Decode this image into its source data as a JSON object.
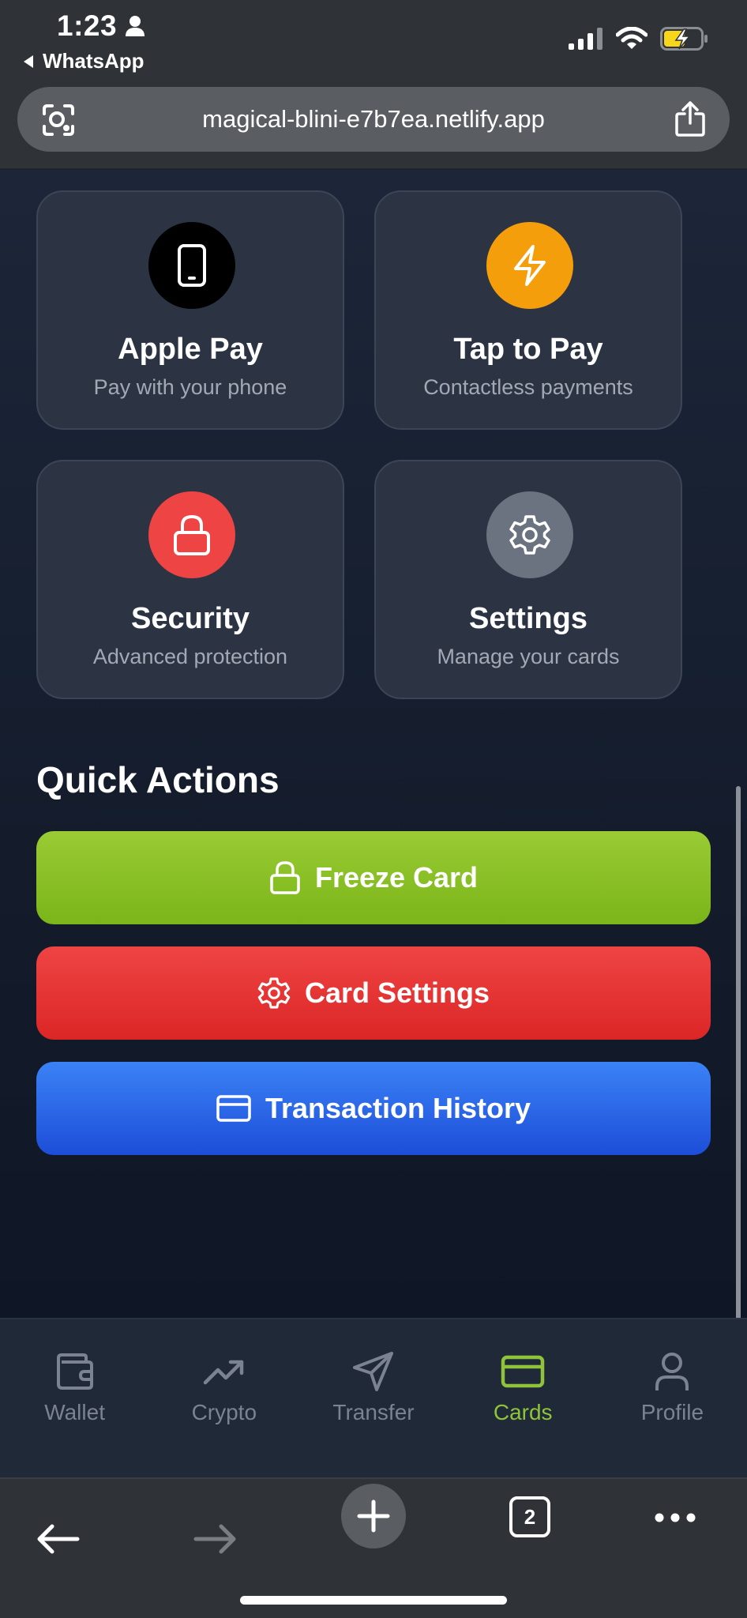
{
  "status": {
    "time": "1:23",
    "back_app": "WhatsApp"
  },
  "browser": {
    "url": "magical-blini-e7b7ea.netlify.app",
    "tab_count": "2"
  },
  "features": [
    {
      "title": "Apple Pay",
      "subtitle": "Pay with your phone",
      "icon": "phone-icon",
      "color": "#000000"
    },
    {
      "title": "Tap to Pay",
      "subtitle": "Contactless payments",
      "icon": "lightning-icon",
      "color": "#f59e0b"
    },
    {
      "title": "Security",
      "subtitle": "Advanced protection",
      "icon": "lock-icon",
      "color": "#ef4444"
    },
    {
      "title": "Settings",
      "subtitle": "Manage your cards",
      "icon": "gear-icon",
      "color": "#6b7280"
    }
  ],
  "quick_actions": {
    "title": "Quick Actions",
    "buttons": [
      {
        "label": "Freeze Card",
        "icon": "lock-icon",
        "color": "#84cc16"
      },
      {
        "label": "Card Settings",
        "icon": "gear-icon",
        "color": "#ef4444"
      },
      {
        "label": "Transaction History",
        "icon": "card-icon",
        "color": "#2563eb"
      }
    ]
  },
  "tabbar": {
    "items": [
      {
        "label": "Wallet",
        "icon": "wallet-icon",
        "active": false
      },
      {
        "label": "Crypto",
        "icon": "trending-up-icon",
        "active": false
      },
      {
        "label": "Transfer",
        "icon": "send-icon",
        "active": false
      },
      {
        "label": "Cards",
        "icon": "card-icon",
        "active": true
      },
      {
        "label": "Profile",
        "icon": "user-icon",
        "active": false
      }
    ],
    "active_color": "#8fc43a"
  }
}
